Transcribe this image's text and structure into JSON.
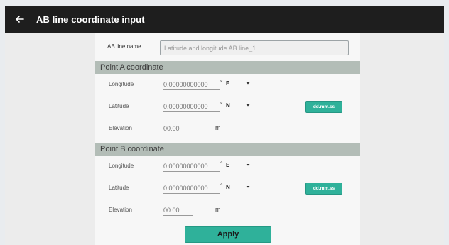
{
  "header": {
    "title": "AB line coordinate input",
    "back_icon": "arrow-left-icon"
  },
  "ab_line_name": {
    "label": "AB line name",
    "placeholder": "Latitude and longitude AB line_1"
  },
  "point_a": {
    "title": "Point A coordinate",
    "longitude": {
      "label": "Longitude",
      "placeholder": "0.00000000000",
      "degree": "°",
      "direction": "E"
    },
    "latitude": {
      "label": "Latitude",
      "placeholder": "0.00000000000",
      "degree": "°",
      "direction": "N"
    },
    "elevation": {
      "label": "Elevation",
      "placeholder": "00.00",
      "unit": "m"
    },
    "format_button": "dd.mm.ss"
  },
  "point_b": {
    "title": "Point B coordinate",
    "longitude": {
      "label": "Longitude",
      "placeholder": "0.00000000000",
      "degree": "°",
      "direction": "E"
    },
    "latitude": {
      "label": "Latitude",
      "placeholder": "0.00000000000",
      "degree": "°",
      "direction": "N"
    },
    "elevation": {
      "label": "Elevation",
      "placeholder": "00.00",
      "unit": "m"
    },
    "format_button": "dd.mm.ss"
  },
  "apply_button": "Apply",
  "colors": {
    "accent": "#2fb19a",
    "header_bg": "#1e1e1e",
    "section_bg": "#b3bdb7"
  }
}
